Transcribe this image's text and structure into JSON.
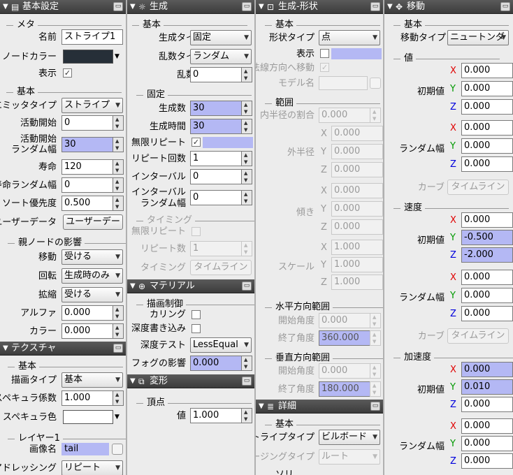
{
  "p1": {
    "title": "基本設定",
    "meta": "メタ",
    "name_label": "名前",
    "name_value": "ストライプ1",
    "nodecolor_label": "ノードカラー",
    "nodecolor": "#262f38",
    "show_label": "表示",
    "show_check": "✓",
    "basic": "基本",
    "emitter_label": "エミッタタイプ",
    "emitter_value": "ストライプ",
    "active_label": "活動開始",
    "active_value": "0",
    "active_rand_label1": "活動開始",
    "active_rand_label2": "ランダム幅",
    "active_rand_value": "30",
    "life_label": "寿命",
    "life_value": "120",
    "life_rand_label": "寿命ランダム幅",
    "life_rand_value": "0",
    "sort_label": "ソート優先度",
    "sort_value": "0.500",
    "userdata_label": "ユーザーデータ",
    "userdata_btn": "ユーザーデー",
    "parent": "親ノードの影響",
    "move_label": "移動",
    "move_value": "受ける",
    "rot_label": "回転",
    "rot_value": "生成時のみ",
    "scale_label": "拡縮",
    "scale_value": "受ける",
    "alpha_label": "アルファ",
    "alpha_value": "0.000",
    "color_label": "カラー",
    "color_value": "0.000"
  },
  "p2": {
    "title": "テクスチャ",
    "basic": "基本",
    "draw_label": "描画タイプ",
    "draw_value": "基本",
    "spec_label": "スペキュラ係数",
    "spec_value": "1.000",
    "speccol_label": "スペキュラ色",
    "speccol": "#ffffff",
    "layer": "レイヤー1",
    "img_label": "画像名",
    "img_value": "tail",
    "addr_label": "アドレッシング",
    "addr_value": "リピート"
  },
  "p3": {
    "title": "生成",
    "basic": "基本",
    "gentype_label": "生成タイプ",
    "gentype_value": "固定",
    "randtype_label": "乱数タイプ",
    "randtype_value": "ランダム",
    "seed_label": "乱数種",
    "seed_value": "0",
    "fixed": "固定",
    "count_label": "生成数",
    "count_value": "30",
    "time_label": "生成時間",
    "time_value": "30",
    "inf_label": "無限リピート",
    "inf_check": "✓",
    "rep_label": "リピート回数",
    "rep_value": "1",
    "interval_label": "インターバル",
    "interval_value": "0",
    "int_rand_label1": "インターバル",
    "int_rand_label2": "ランダム幅",
    "int_rand_value": "0",
    "timing": "タイミング",
    "t_inf_label": "無限リピート",
    "t_rep_label": "リピート数",
    "t_rep_value": "1",
    "t_timing_label": "タイミング",
    "t_timeline_btn": "タイムライン"
  },
  "p4": {
    "title": "マテリアル",
    "drawctrl": "描画制御",
    "cull_label": "カリング",
    "depthw_label": "深度書き込み",
    "depthtest_label": "深度テスト",
    "depthtest_value": "LessEqual",
    "fog_label": "フォグの影響",
    "fog_value": "0.000"
  },
  "p5": {
    "title": "変形",
    "vertex": "頂点",
    "value_label": "値",
    "value_value": "1.000"
  },
  "p6": {
    "title": "生成-形状",
    "basic": "基本",
    "shape_label": "形状タイプ",
    "shape_value": "点",
    "show_label": "表示",
    "normal_label": "法線方向へ移動",
    "normal_check": "✓",
    "model_label": "モデル名",
    "range": "範囲",
    "inner_label": "内半径の割合",
    "inner_value": "0.000",
    "outer_label": "外半径",
    "tilt_label": "傾き",
    "scale_label": "スケール",
    "xyz": [
      "X",
      "Y",
      "Z"
    ],
    "outer_values": [
      "0.000",
      "0.000",
      "0.000"
    ],
    "tilt_values": [
      "0.000",
      "0.000",
      "0.000"
    ],
    "scale_values": [
      "1.000",
      "1.000",
      "1.000"
    ],
    "hrange": "水平方向範囲",
    "h_start_label": "開始角度",
    "h_start_value": "0.000",
    "h_end_label": "終了角度",
    "h_end_value": "360.000",
    "vrange": "垂直方向範囲",
    "v_start_label": "開始角度",
    "v_start_value": "0.000",
    "v_end_label": "終了角度",
    "v_end_value": "180.000"
  },
  "p7": {
    "title": "詳細",
    "basic": "基本",
    "stripe_label": "ストライプタイプ",
    "stripe_value": "ビルボード",
    "easing_label": "イージングタイプ",
    "easing_value": "ルート",
    "more": "ソリ"
  },
  "p8": {
    "title": "移動",
    "basic": "基本",
    "movetype_label": "移動タイプ",
    "movetype_value": "ニュートンダ",
    "value_sec": "値",
    "init_label": "初期値",
    "rand_label": "ランダム幅",
    "curve_label": "カーブ",
    "timeline_btn": "タイムライン",
    "xyz": [
      "X",
      "Y",
      "Z"
    ],
    "val_init": [
      "0.000",
      "0.000",
      "0.000"
    ],
    "val_rand": [
      "0.000",
      "0.000",
      "0.000"
    ],
    "speed_sec": "速度",
    "spd_init": [
      "0.000",
      "-0.500",
      "-2.000"
    ],
    "spd_rand": [
      "0.000",
      "0.000",
      "0.000"
    ],
    "accel_sec": "加速度",
    "acc_init": [
      "0.000",
      "0.010",
      "0.000"
    ],
    "acc_rand": [
      "0.000",
      "0.000",
      "0.000"
    ]
  }
}
